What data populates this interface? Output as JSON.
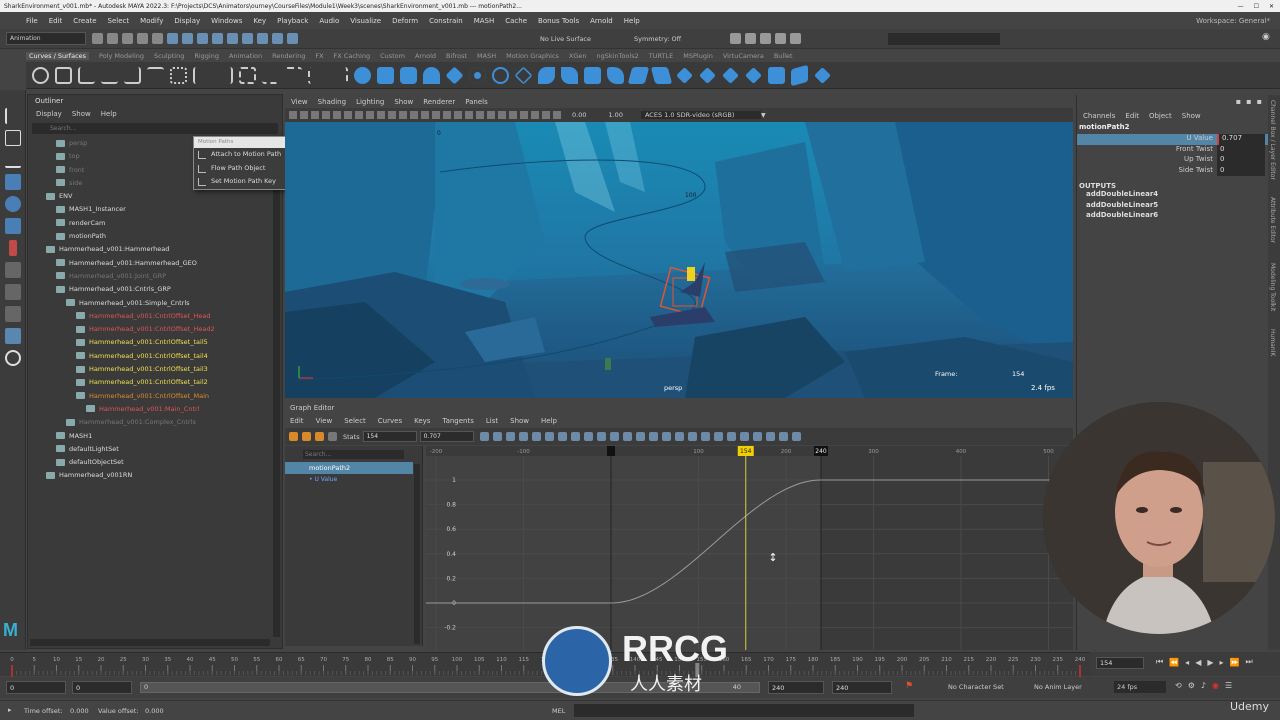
{
  "titlebar": {
    "text": "SharkEnvironment_v001.mb* - Autodesk MAYA 2022.3: F:\\Projects\\DCS\\Animators\\ourney\\CourseFiles\\Module1\\Week3\\scenes\\SharkEnvironment_v001.mb  ---  motionPath2..."
  },
  "menubar": [
    "File",
    "Edit",
    "Create",
    "Select",
    "Modify",
    "Display",
    "Windows",
    "Key",
    "Playback",
    "Audio",
    "Visualize",
    "Deform",
    "Constrain",
    "MASH",
    "Cache",
    "Bonus Tools",
    "Arnold",
    "Help"
  ],
  "workspace": "Workspace: General*",
  "statusline": {
    "menuset": "Animation",
    "live_surface": "No Live Surface",
    "symmetry": "Symmetry: Off"
  },
  "shelf_tabs": [
    "Curves / Surfaces",
    "Poly Modeling",
    "Sculpting",
    "Rigging",
    "Animation",
    "Rendering",
    "FX",
    "FX Caching",
    "Custom",
    "Arnold",
    "Bifrost",
    "MASH",
    "Motion Graphics",
    "XGen",
    "ngSkinTools2",
    "TURTLE",
    "MSPlugin",
    "VirtuCamera",
    "Bullet"
  ],
  "outliner": {
    "title": "Outliner",
    "menus": [
      "Display",
      "Show",
      "Help"
    ],
    "search_placeholder": "Search...",
    "items": [
      {
        "label": "persp",
        "style": "dim"
      },
      {
        "label": "top",
        "style": "dim"
      },
      {
        "label": "front",
        "style": "dim"
      },
      {
        "label": "side",
        "style": "dim"
      },
      {
        "label": "ENV",
        "style": ""
      },
      {
        "label": "MASH1_Instancer",
        "style": ""
      },
      {
        "label": "renderCam",
        "style": ""
      },
      {
        "label": "motionPath",
        "style": ""
      },
      {
        "label": "Hammerhead_v001:Hammerhead",
        "style": ""
      },
      {
        "label": "Hammerhead_v001:Hammerhead_GEO",
        "style": ""
      },
      {
        "label": "Hammerhead_v001:Joint_GRP",
        "style": "dim"
      },
      {
        "label": "Hammerhead_v001:Cntrls_GRP",
        "style": ""
      },
      {
        "label": "Hammerhead_v001:Simple_Cntrls",
        "style": ""
      },
      {
        "label": "Hammerhead_v001:CntrlOffset_Head",
        "style": "red"
      },
      {
        "label": "Hammerhead_v001:CntrlOffset_Head2",
        "style": "red"
      },
      {
        "label": "Hammerhead_v001:CntrlOffset_tail5",
        "style": "yel"
      },
      {
        "label": "Hammerhead_v001:CntrlOffset_tail4",
        "style": "yel"
      },
      {
        "label": "Hammerhead_v001:CntrlOffset_tail3",
        "style": "yel"
      },
      {
        "label": "Hammerhead_v001:CntrlOffset_tail2",
        "style": "yel"
      },
      {
        "label": "Hammerhead_v001:CntrlOffset_Main",
        "style": "ora"
      },
      {
        "label": "Hammerhead_v001:Main_Cntrl",
        "style": "red"
      },
      {
        "label": "Hammerhead_v001:Complex_Cntrls",
        "style": "dim"
      },
      {
        "label": "MASH1",
        "style": ""
      },
      {
        "label": "defaultLightSet",
        "style": ""
      },
      {
        "label": "defaultObjectSet",
        "style": ""
      },
      {
        "label": "Hammerhead_v001RN",
        "style": ""
      }
    ]
  },
  "popup": {
    "title": "Motion Paths",
    "items": [
      "Attach to Motion Path",
      "Flow Path Object",
      "Set Motion Path Key"
    ]
  },
  "viewport": {
    "menus": [
      "View",
      "Shading",
      "Lighting",
      "Show",
      "Renderer",
      "Panels"
    ],
    "near": "0.00",
    "far": "1.00",
    "colorspace": "ACES 1.0 SDR-video (sRGB)",
    "camera": "persp",
    "frame_label": "Frame:",
    "frame_value": "154",
    "fps": "2.4 fps",
    "path_mark_0": "0",
    "path_mark_100": "100"
  },
  "graph_editor": {
    "title": "Graph Editor",
    "menus": [
      "Edit",
      "View",
      "Select",
      "Curves",
      "Keys",
      "Tangents",
      "List",
      "Show",
      "Help"
    ],
    "stats_label": "Stats",
    "stats_frame": "154",
    "stats_value": "0.707",
    "search_placeholder": "Search...",
    "node": "motionPath2",
    "attr": "U Value",
    "x_ticks": [
      "-200",
      "-100",
      "0",
      "100",
      "154",
      "200",
      "240",
      "300",
      "400",
      "500"
    ],
    "y_ticks": [
      "1",
      "0.8",
      "0.6",
      "0.4",
      "0.2",
      "0",
      "-0.2"
    ]
  },
  "channel_box": {
    "menus": [
      "Channels",
      "Edit",
      "Object",
      "Show"
    ],
    "node": "motionPath2",
    "attrs": [
      {
        "name": "U Value",
        "value": "0.707"
      },
      {
        "name": "Front Twist",
        "value": "0"
      },
      {
        "name": "Up Twist",
        "value": "0"
      },
      {
        "name": "Side Twist",
        "value": "0"
      }
    ],
    "outputs_label": "OUTPUTS",
    "outputs": [
      "addDoubleLinear4",
      "addDoubleLinear5",
      "addDoubleLinear6"
    ]
  },
  "side_tabs": [
    "Channel Box / Layer Editor",
    "Attribute Editor",
    "Modeling Toolkit",
    "HumanIK"
  ],
  "timeslider": {
    "ticks": [
      "0",
      "5",
      "10",
      "15",
      "20",
      "25",
      "30",
      "35",
      "40",
      "45",
      "50",
      "55",
      "60",
      "65",
      "70",
      "75",
      "80",
      "85",
      "90",
      "95",
      "100",
      "105",
      "110",
      "115",
      "120",
      "125",
      "130",
      "135",
      "140",
      "145",
      "150",
      "155",
      "160",
      "165",
      "170",
      "175",
      "180",
      "185",
      "190",
      "195",
      "200",
      "205",
      "210",
      "215",
      "220",
      "225",
      "230",
      "235",
      "240"
    ],
    "current_frame": "154"
  },
  "range": {
    "start": "0",
    "start2": "0",
    "slider_start": "0",
    "end_a": "40",
    "end": "240",
    "end2": "240",
    "character_set": "No Character Set",
    "anim_layer": "No Anim Layer",
    "fps": "24 fps"
  },
  "cmdline": {
    "time_offset_label": "Time offset:",
    "time_offset": "0.000",
    "value_offset_label": "Value offset:",
    "value_offset": "0.000",
    "lang": "MEL"
  },
  "watermark": {
    "brand": "RRCG",
    "sub": "人人素材",
    "corner": "Udemy"
  },
  "colors": {
    "accent": "#5285a6",
    "key_yellow": "#f0d000",
    "curve": "#9a9a9a"
  }
}
